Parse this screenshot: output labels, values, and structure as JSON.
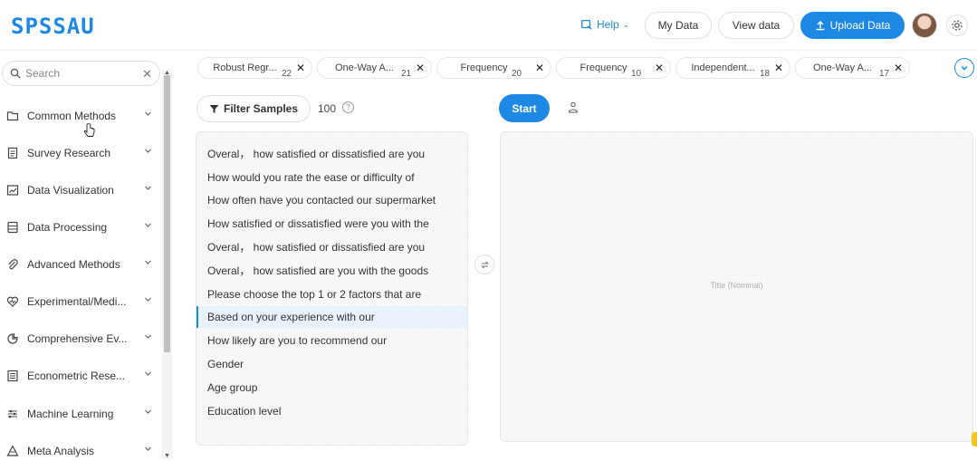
{
  "header": {
    "logo": "SPSSAU",
    "help_label": "Help",
    "my_data_label": "My Data",
    "view_data_label": "View data",
    "upload_label": "Upload Data"
  },
  "sidebar": {
    "search_placeholder": "Search",
    "items": [
      {
        "label": "Common Methods",
        "icon": "folder-icon"
      },
      {
        "label": "Survey Research",
        "icon": "clipboard-icon"
      },
      {
        "label": "Data Visualization",
        "icon": "chart-icon"
      },
      {
        "label": "Data Processing",
        "icon": "database-icon"
      },
      {
        "label": "Advanced Methods",
        "icon": "paperclip-icon"
      },
      {
        "label": "Experimental/Medi...",
        "icon": "heart-pulse-icon"
      },
      {
        "label": "Comprehensive Ev...",
        "icon": "pie-chart-icon"
      },
      {
        "label": "Econometric Rese...",
        "icon": "table-icon"
      },
      {
        "label": "Machine Learning",
        "icon": "sliders-icon"
      },
      {
        "label": "Meta Analysis",
        "icon": "triangle-icon"
      }
    ]
  },
  "tabs": [
    {
      "label": "Robust Regr...",
      "count": "22"
    },
    {
      "label": "One-Way A...",
      "count": "21"
    },
    {
      "label": "Frequency",
      "count": "20"
    },
    {
      "label": "Frequency",
      "count": "10"
    },
    {
      "label": "Independent...",
      "count": "18"
    },
    {
      "label": "One-Way A...",
      "count": "17"
    }
  ],
  "toolbar": {
    "filter_label": "Filter Samples",
    "sample_count": "100",
    "start_label": "Start"
  },
  "variables": [
    "Overal，  how satisfied or dissatisfied are you",
    "How would you rate the ease or difficulty of",
    "How often have you contacted our supermarket",
    "How satisfied or dissatisfied were you with the",
    "Overal，  how satisfied or dissatisfied are you",
    "Overal，  how satisfied are you with the goods",
    "Please choose the top 1 or 2 factors that are",
    "Based on your experience with our",
    "How likely are you to recommend our",
    "Gender",
    "Age group",
    "Education level"
  ],
  "selected_variable_index": 7,
  "drop_area": {
    "label": "Title (Nominal)"
  },
  "colors": {
    "accent": "#1e88e5",
    "selected_bg": "#e9f2fc"
  }
}
